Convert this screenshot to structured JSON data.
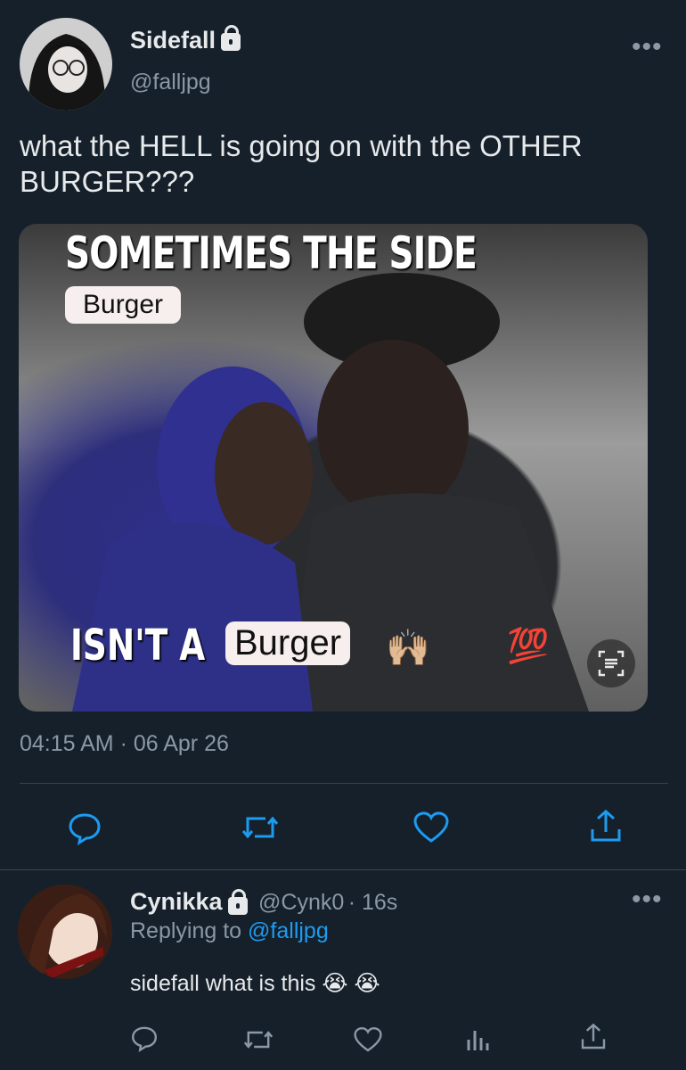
{
  "tweet": {
    "display_name": "Sidefall",
    "handle": "@falljpg",
    "text": "what the HELL is going on with the OTHER BURGER???",
    "image": {
      "top_caption": "SOMETIMES THE SIDE",
      "patch_top": "Burger",
      "bottom_caption": "ISN'T A",
      "patch_bottom": "Burger",
      "emoji_hands": "🙌🏼",
      "emoji_100": "💯"
    },
    "time": "04:15 AM · 06 Apr 26",
    "more_label": "•••"
  },
  "actions": {
    "reply": "reply-icon",
    "retweet": "retweet-icon",
    "like": "heart-icon",
    "share": "share-icon"
  },
  "reply": {
    "display_name": "Cynikka",
    "handle": "@Cynk0",
    "age": "· 16s",
    "replying_prefix": "Replying to",
    "replying_to": "@falljpg",
    "text": "sidefall what is this 😭 😭",
    "more_label": "•••"
  },
  "colors": {
    "background": "#15202b",
    "text": "#e7e9ea",
    "secondary": "#8b98a5",
    "link": "#1d9bf0",
    "divider": "#38444d"
  }
}
